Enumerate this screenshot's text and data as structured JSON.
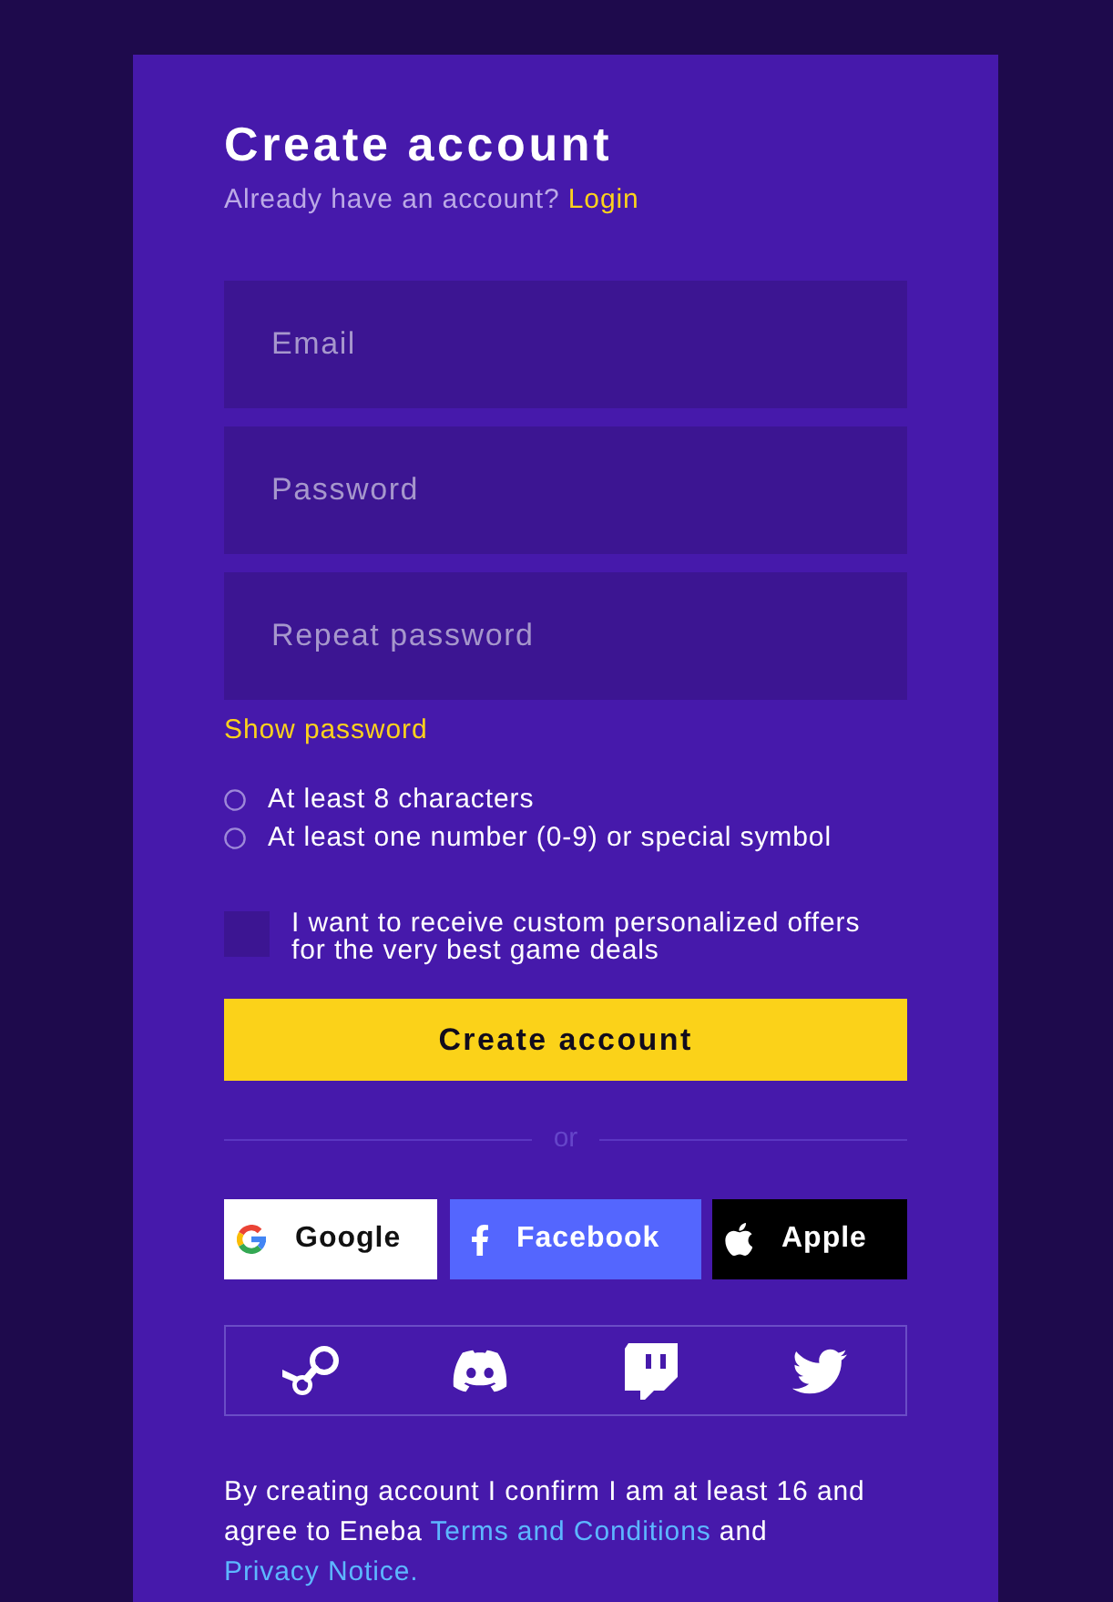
{
  "header": {
    "title": "Create account",
    "subtitle": "Already have an account?",
    "login_link": "Login"
  },
  "fields": [
    {
      "placeholder": "Email"
    },
    {
      "placeholder": "Password"
    },
    {
      "placeholder": "Repeat password"
    }
  ],
  "show_password": "Show password",
  "requirements": [
    {
      "text": "At least 8 characters",
      "met": false
    },
    {
      "text": "At least one number (0-9) or special symbol",
      "met": false
    }
  ],
  "offers_checkbox": {
    "label": "I want to receive custom personalized offers for the very best game deals",
    "checked": false
  },
  "submit_button": "Create account",
  "divider": "or",
  "social_buttons": [
    {
      "kind": "google",
      "label": "Google"
    },
    {
      "kind": "facebook",
      "label": "Facebook"
    },
    {
      "kind": "apple",
      "label": "Apple"
    }
  ],
  "icon_buttons": [
    {
      "kind": "steam"
    },
    {
      "kind": "discord"
    },
    {
      "kind": "twitch"
    },
    {
      "kind": "twitter"
    }
  ],
  "legal": {
    "text": "By creating account I confirm I am at least 16 and agree to Eneba",
    "terms_link": "Terms and Conditions",
    "joiner": "and",
    "privacy_link": "Privacy Notice."
  }
}
